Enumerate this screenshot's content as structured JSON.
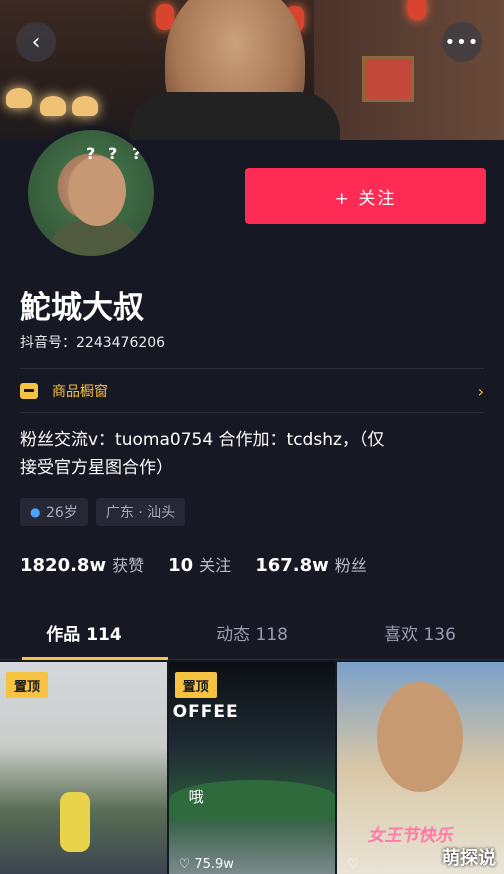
{
  "header": {
    "back_icon": "chevron-left-icon",
    "more_icon": "more-dots-icon",
    "more_label": "•••"
  },
  "profile": {
    "follow_label": "+ 关注",
    "name": "鮀城大叔",
    "douyin_id": "抖音号：2243476206",
    "shop_label": "商品橱窗",
    "bio_line1": "粉丝交流v：tuoma0754  合作加：tcdshz，（仅",
    "bio_line2": "接受官方星图合作）",
    "tags": {
      "age": "26岁",
      "location": "广东 · 汕头"
    },
    "stats": {
      "likes_num": "1820.8w",
      "likes_label": "获赞",
      "following_num": "10",
      "following_label": "关注",
      "fans_num": "167.8w",
      "fans_label": "粉丝"
    }
  },
  "tabs": [
    {
      "label": "作品 114"
    },
    {
      "label": "动态 118"
    },
    {
      "label": "喜欢 136"
    }
  ],
  "grid": {
    "pin_label": "置顶",
    "video2_likes": "75.9w",
    "video2_text": "OFFEE",
    "video2_caption": "哦",
    "video3_caption": "女王节快乐",
    "watermark": "萌探说"
  },
  "colors": {
    "accent": "#fe2c55",
    "gold": "#f5c242",
    "background": "#161824"
  }
}
